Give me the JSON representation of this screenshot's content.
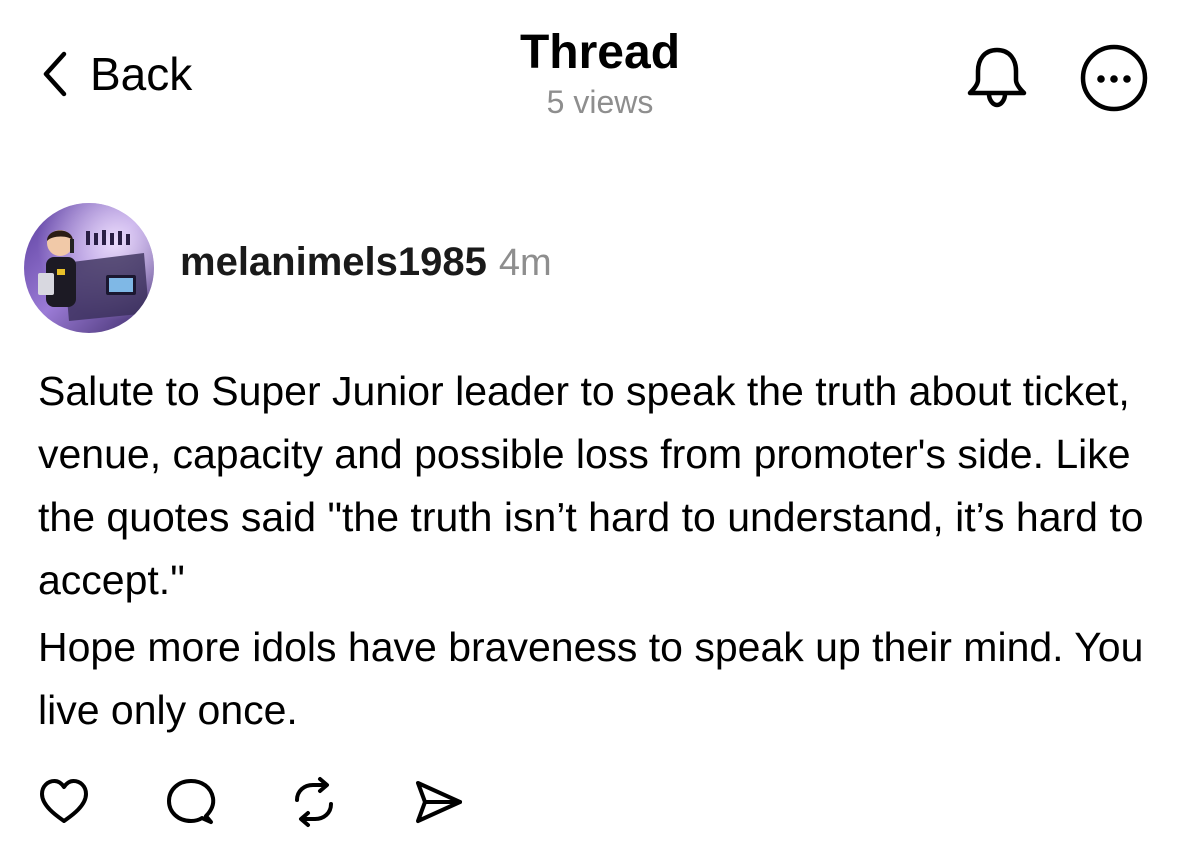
{
  "header": {
    "back_label": "Back",
    "title": "Thread",
    "views": "5 views",
    "bell_icon": "bell-icon",
    "more_icon": "more-horizontal-icon"
  },
  "post": {
    "username": "melanimels1985",
    "time": "4m",
    "paragraphs": [
      "Salute to Super Junior leader to speak the truth about ticket, venue, capacity and possible loss from promoter's side. Like the quotes said \"the truth isn’t hard to understand, it’s hard to accept.\"",
      "Hope more idols have braveness to speak up their mind. You live only once."
    ]
  },
  "actions": {
    "like_icon": "heart-icon",
    "reply_icon": "comment-icon",
    "repost_icon": "repost-icon",
    "share_icon": "send-icon"
  },
  "colors": {
    "text": "#000000",
    "secondary_text": "#8e8e8e",
    "background": "#ffffff"
  }
}
